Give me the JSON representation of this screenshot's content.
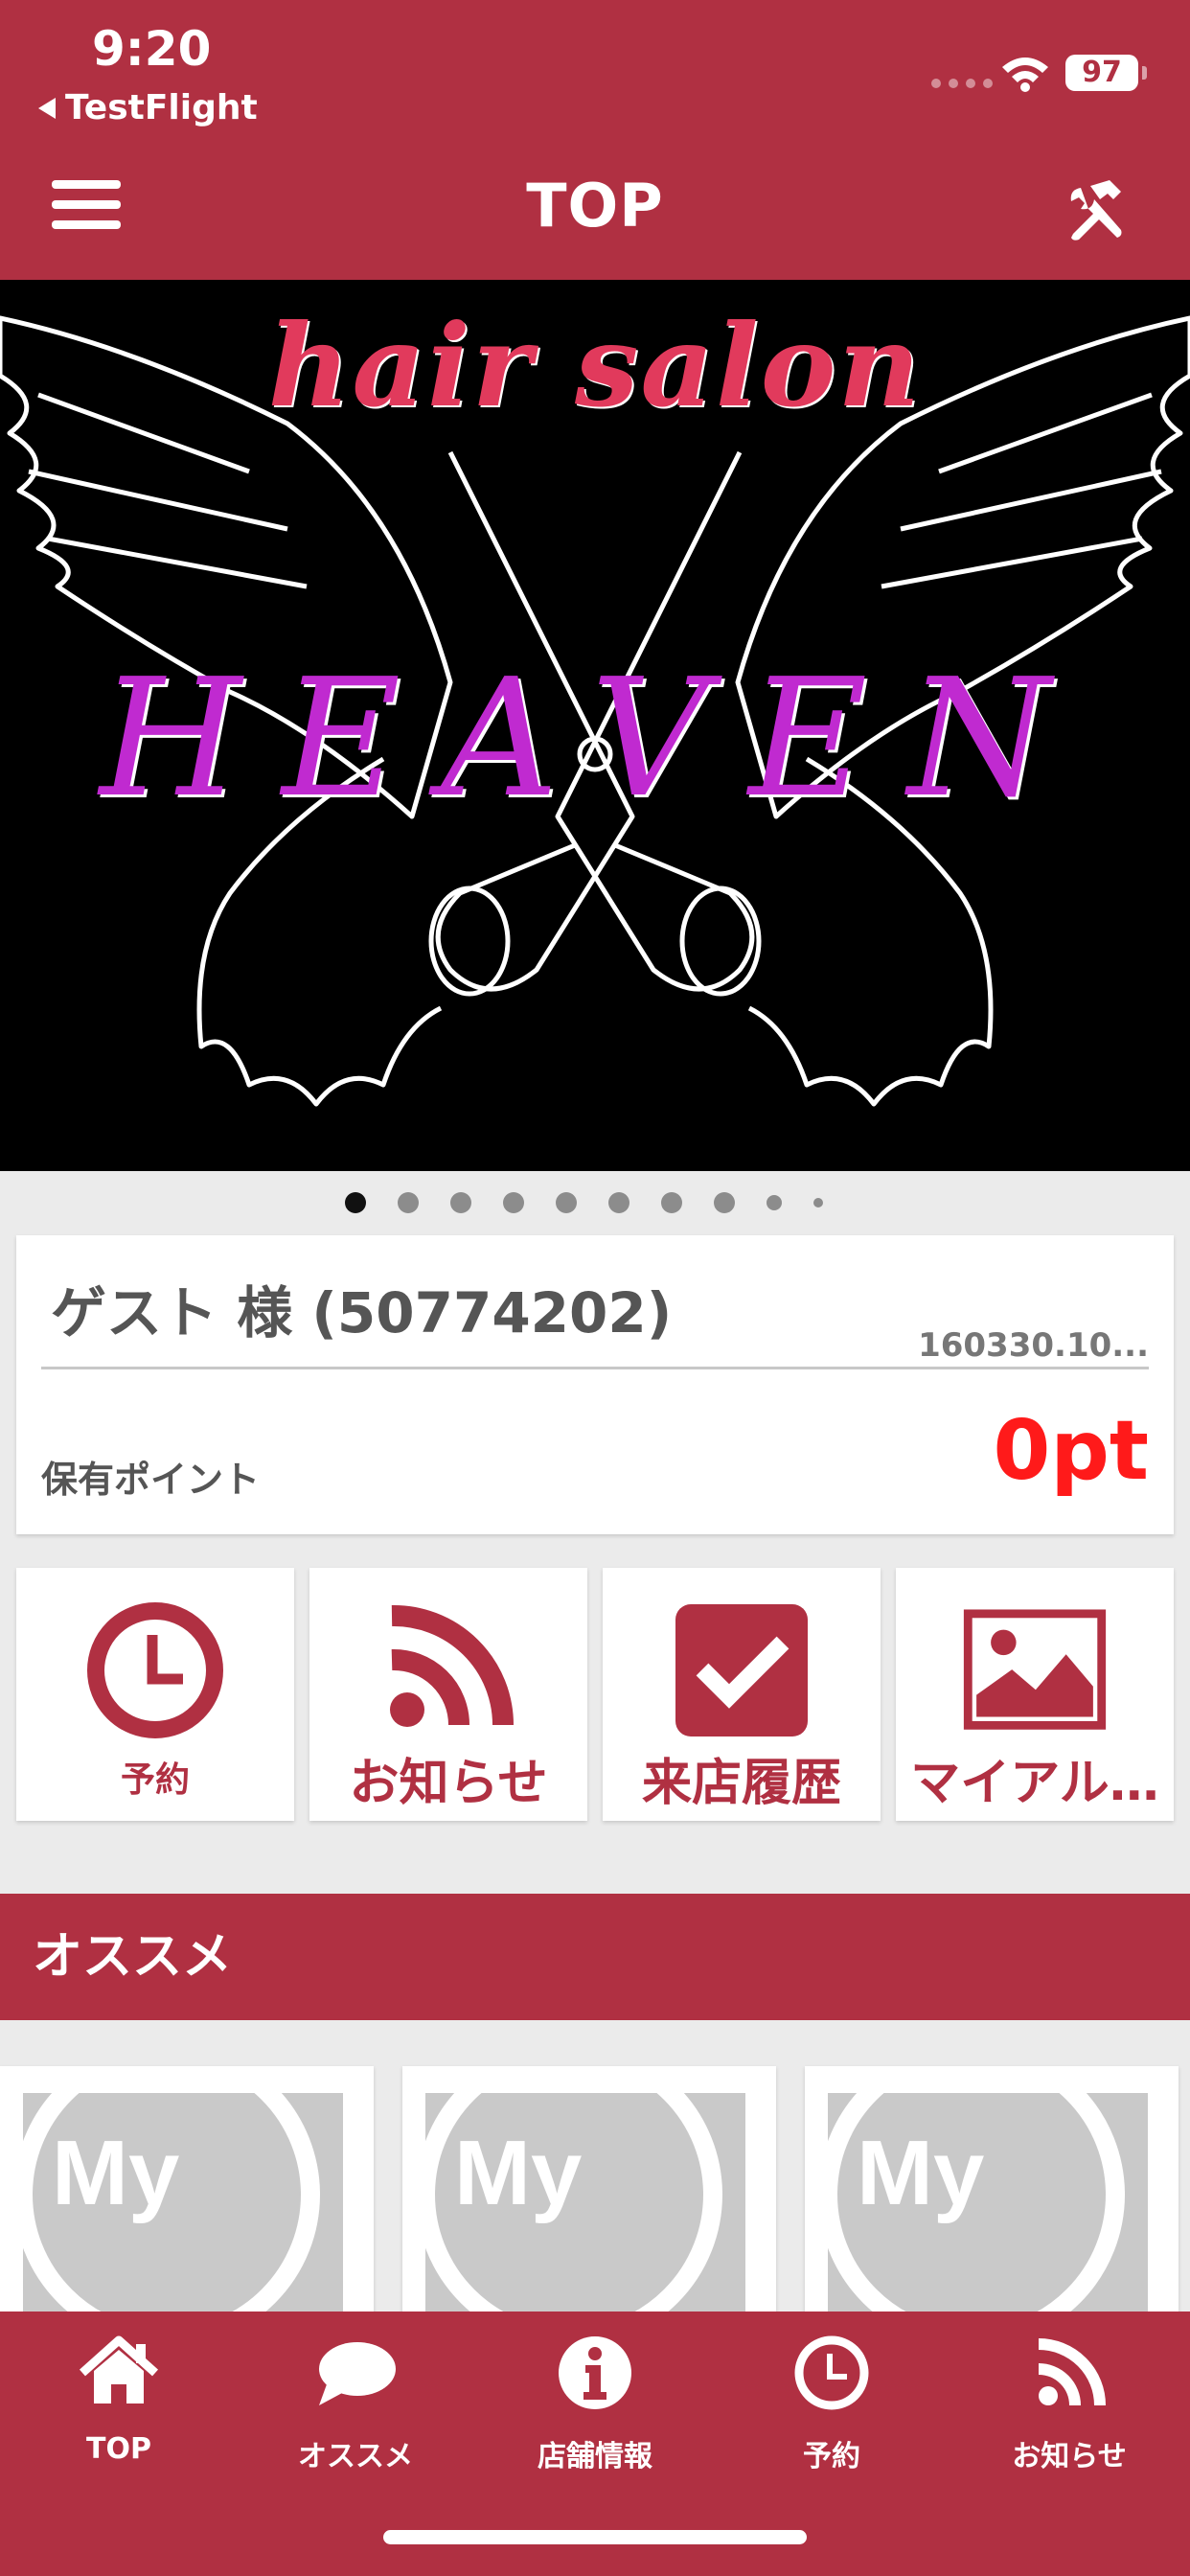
{
  "status_bar": {
    "time": "9:20",
    "back_app": "TestFlight",
    "battery": "97"
  },
  "header": {
    "title": "TOP",
    "menu_icon": "hamburger-menu-icon",
    "tools_icon": "hammer-wrench-icon"
  },
  "banner": {
    "line1": "hair salon",
    "line2": "HEAVEN",
    "pages": 10,
    "active_page": 1
  },
  "member": {
    "name": "ゲスト 様 (50774202)",
    "code": "160330.10...",
    "points_label": "保有ポイント",
    "points_value": "0pt"
  },
  "tiles": [
    {
      "label": "予約",
      "icon": "clock-icon"
    },
    {
      "label": "お知らせ",
      "icon": "rss-feed-icon"
    },
    {
      "label": "来店履歴",
      "icon": "checkbox-icon"
    },
    {
      "label": "マイアル…",
      "icon": "photo-album-icon"
    }
  ],
  "recommend": {
    "title": "オススメ",
    "placeholder_text": "My"
  },
  "tabbar": [
    {
      "label": "TOP",
      "icon": "home-icon"
    },
    {
      "label": "オススメ",
      "icon": "speech-bubble-icon"
    },
    {
      "label": "店舗情報",
      "icon": "info-icon"
    },
    {
      "label": "予約",
      "icon": "clock-icon"
    },
    {
      "label": "お知らせ",
      "icon": "rss-feed-icon"
    }
  ],
  "colors": {
    "brand": "#b03042",
    "points": "#ff1a1a",
    "background": "#ebebeb"
  }
}
